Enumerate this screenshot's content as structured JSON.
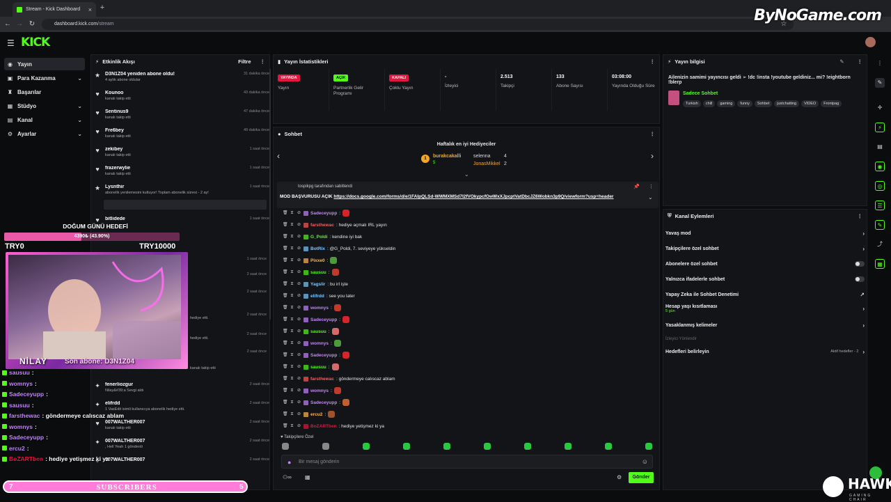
{
  "browser": {
    "tab_title": "Stream - Kick Dashboard",
    "url_host": "dashboard.kick.com",
    "url_path": "/stream",
    "watermark": "ByNoGame.com"
  },
  "app": {
    "logo": "KICK"
  },
  "sidebar": {
    "items": [
      {
        "label": "Yayın",
        "icon": "broadcast-icon",
        "chevron": false,
        "active": true
      },
      {
        "label": "Para Kazanma",
        "icon": "wallet-icon",
        "chevron": true,
        "active": false
      },
      {
        "label": "Başarılar",
        "icon": "trophy-icon",
        "chevron": false,
        "active": false
      },
      {
        "label": "Stüdyo",
        "icon": "studio-icon",
        "chevron": true,
        "active": false
      },
      {
        "label": "Kanal",
        "icon": "channel-icon",
        "chevron": true,
        "active": false
      },
      {
        "label": "Ayarlar",
        "icon": "gear-icon",
        "chevron": true,
        "active": false
      }
    ]
  },
  "activity": {
    "title": "Etkinlik Akışı",
    "filter": "Filtre",
    "rows": [
      {
        "name": "D3N1Z04 yeniden abone oldu!",
        "sub": "4 aylık abone oldular",
        "time": "31 dakika önce",
        "icon": "star-icon"
      },
      {
        "name": "Kounoo",
        "sub": "kanalı takip etti",
        "time": "43 dakika önce",
        "icon": "heart-icon"
      },
      {
        "name": "Sentinus9",
        "sub": "kanalı takip etti",
        "time": "47 dakika önce",
        "icon": "heart-icon"
      },
      {
        "name": "Fre6bey",
        "sub": "kanalı takip etti",
        "time": "49 dakika önce",
        "icon": "heart-icon"
      },
      {
        "name": "zekibey",
        "sub": "kanalı takip etti",
        "time": "1 saat önce",
        "icon": "heart-icon"
      },
      {
        "name": "frazerwylie",
        "sub": "kanalı takip etti",
        "time": "1 saat önce",
        "icon": "heart-icon"
      },
      {
        "name": "Lysnthir",
        "sub": "abonelik yenilemesini kutluyor! Toplam abonelik süresi - 2 ay!",
        "time": "1 saat önce",
        "icon": "star-icon"
      },
      {
        "name": "bitlidede",
        "sub": "",
        "time": "1 saat önce",
        "icon": "heart-icon"
      },
      {
        "name": "fenerliozgur",
        "sub": "Nilay&#39;a Sevgi aldı",
        "time": "2 saat önce",
        "icon": "gift-icon"
      },
      {
        "name": "elifrdd",
        "sub": "1 VasEdit isimli kullanıcıya abonelik hediye etti.",
        "time": "2 saat önce",
        "icon": "gift-icon"
      },
      {
        "name": "007WALTHER007",
        "sub": "kanalı takip etti",
        "time": "2 saat önce",
        "icon": "heart-icon"
      },
      {
        "name": "007WALTHER007",
        "sub": ", Hell Yeah 1 gönderdi",
        "time": "2 saat önce",
        "icon": "gift-icon"
      },
      {
        "name": "007WALTHER007",
        "sub": "",
        "time": "2 saat önce",
        "icon": "gift-icon"
      }
    ],
    "extra_times": [
      "1 saat önce",
      "2 saat önce",
      "2 saat önce",
      "2 saat önce",
      "2 saat önce",
      "2 saat önce"
    ],
    "partial_subs": [
      "hediye etti.",
      "hediye etti.",
      "kanalı takip etti"
    ]
  },
  "stats": {
    "title": "Yayın İstatistikleri",
    "items": [
      {
        "badge": "YAYINDA",
        "badge_color": "#e4153f",
        "value": "",
        "label": "Yayın"
      },
      {
        "badge": "AÇIK",
        "badge_color": "#53fc18",
        "value": "",
        "label": "Partnerlik Gelir Programı"
      },
      {
        "badge": "KAPALI",
        "badge_color": "#e4153f",
        "value": "",
        "label": "Çoklu Yayın"
      },
      {
        "badge": "",
        "value": "-",
        "label": "İzleyici"
      },
      {
        "badge": "",
        "value": "2.513",
        "label": "Takipçi"
      },
      {
        "badge": "",
        "value": "133",
        "label": "Abone Sayısı"
      },
      {
        "badge": "",
        "value": "03:08:00",
        "label": "Yayında Olduğu Süre"
      }
    ]
  },
  "chat": {
    "title": "Sohbet",
    "gifters_title": "Haftalık en iyi Hediyeciler",
    "gifters": [
      {
        "name": "burakcakalli",
        "count": "5",
        "rank": "1"
      },
      {
        "name": "selenna",
        "count": "4"
      },
      {
        "name": "JonasMikkel",
        "count": "2"
      }
    ],
    "pinned_by": "tospikpg tarafından sabitlendi",
    "pinned_prefix": "MOD BAŞVURUSU AÇIK",
    "pinned_link": "https://docs.google.com/forms/d/e/1FAIpQLSd-WWMXMSd7I2fVOkypcfOwWxXJpcptVatDbcJZ6Wobkn3p9Q/viewform?usp=header",
    "messages": [
      {
        "user": "Sadeceyupp",
        "msg": ":",
        "color": "#c583ff",
        "emote": "#d8232a"
      },
      {
        "user": "farsthewac",
        "msg": ": hediye açmalı IRL yayın",
        "color": "#ff5a5a",
        "emote": ""
      },
      {
        "user": "G_Poldi",
        "msg": ": kendine iyi bak",
        "color": "#53fc18",
        "emote": ""
      },
      {
        "user": "BotRix",
        "msg": ": @G_Poldi, 7. seviyeye yükseldin",
        "color": "#7ec8ff",
        "emote": ""
      },
      {
        "user": "Pixxe0",
        "msg": ":",
        "color": "#ffb84d",
        "emote": "#4e9a3a"
      },
      {
        "user": "sausuu",
        "msg": ":",
        "color": "#53fc18",
        "emote": "#c0392b"
      },
      {
        "user": "Yagslir",
        "msg": ": bu irl işte",
        "color": "#7ec8ff",
        "emote": ""
      },
      {
        "user": "elifrdd",
        "msg": ": see you later",
        "color": "#7ec8ff",
        "emote": ""
      },
      {
        "user": "womnys",
        "msg": ":",
        "color": "#c583ff",
        "emote": "#c0392b"
      },
      {
        "user": "Sadeceyupp",
        "msg": ":",
        "color": "#c583ff",
        "emote": "#d8232a"
      },
      {
        "user": "sausuu",
        "msg": ":",
        "color": "#53fc18",
        "emote": "#d46a6a"
      },
      {
        "user": "womnys",
        "msg": ":",
        "color": "#c583ff",
        "emote": "#4e9a3a"
      },
      {
        "user": "Sadeceyupp",
        "msg": ":",
        "color": "#c583ff",
        "emote": "#d8232a"
      },
      {
        "user": "sausuu",
        "msg": ":",
        "color": "#53fc18",
        "emote": "#d46a6a"
      },
      {
        "user": "farsthewac",
        "msg": ": göndermeye calıscaz ablam",
        "color": "#ff5a5a",
        "emote": ""
      },
      {
        "user": "womnys",
        "msg": ":",
        "color": "#c583ff",
        "emote": "#c0392b"
      },
      {
        "user": "Sadeceyupp",
        "msg": ":",
        "color": "#c583ff",
        "emote": "#c06030"
      },
      {
        "user": "ercu2",
        "msg": ":",
        "color": "#ffb84d",
        "emote": "#a0522d"
      },
      {
        "user": "BoZARTben",
        "msg": ": hediye yetişmez ki ya",
        "color": "#e4153f",
        "emote": ""
      }
    ],
    "followers_only": "Takipçilere Özel",
    "input_placeholder": "Bir mesaj gönderin",
    "send_label": "Gönder"
  },
  "stream_info": {
    "title": "Yayın bilgisi",
    "stream_title": "Ailenizin samimi yayıncısı geldi ➢ !dc !insta !youtube geldiniz... mi? !eightborn !blerp",
    "category": "Sadece Sohbet",
    "tags": [
      "Turkish",
      "chill",
      "gaming",
      "funny",
      "Sohbet",
      "justchatting",
      "VIDEO",
      "Frontpag"
    ]
  },
  "channel_actions": {
    "title": "Kanal Eylemleri",
    "rows": [
      {
        "label": "Yavaş mod",
        "control": "chevron"
      },
      {
        "label": "Takipçilere özel sohbet",
        "control": "chevron"
      },
      {
        "label": "Abonelere özel sohbet",
        "control": "toggle"
      },
      {
        "label": "Yalnızca ifadelerle sohbet",
        "control": "toggle"
      },
      {
        "label": "Yapay Zeka ile Sohbet Denetimi",
        "control": "external"
      },
      {
        "label": "Hesap yaşı kısıtlaması",
        "sub": "5 gün",
        "control": "chevron"
      },
      {
        "label": "Yasaklanmış kelimeler",
        "control": "chevron"
      },
      {
        "label": "İzleyici Yönlendir",
        "control": "none",
        "disabled": true
      },
      {
        "label": "Hedefleri belirleyin",
        "control": "chevron",
        "extra": "Aktif hedefler - 2"
      }
    ]
  },
  "overlay": {
    "birthday_title": "DOĞUM GÜNÜ HEDEFİ",
    "birthday_progress_text": "4390₺ (43.90%)",
    "birthday_progress": 0.439,
    "goal_min": "TRY0",
    "goal_max": "TRY10000",
    "streamer_name": "NİLAY",
    "last_sub": "Son abone: D3N1Z04",
    "chat": [
      {
        "user": "sausuu",
        "msg": ":"
      },
      {
        "user": "womnys",
        "msg": ":"
      },
      {
        "user": "Sadeceyupp",
        "msg": ":"
      },
      {
        "user": "sausuu",
        "msg": ":"
      },
      {
        "user": "farsthewac",
        "msg": ": göndermeye calıscaz ablam"
      },
      {
        "user": "womnys",
        "msg": ":"
      },
      {
        "user": "Sadeceyupp",
        "msg": ":"
      },
      {
        "user": "ercu2",
        "msg": ":"
      },
      {
        "user": "BoZARTben",
        "msg": ": hediye yetişmez ki ya"
      }
    ],
    "sub_bar_left": "7",
    "sub_bar_label": "SUBSCRIBERS",
    "sub_bar_right": "5",
    "hawk_logo": "HAWK",
    "hawk_sub": "GAMING CHAIR"
  },
  "colors": {
    "kick_green": "#53fc18",
    "live_red": "#e4153f",
    "pink": "#ff5fd0"
  }
}
